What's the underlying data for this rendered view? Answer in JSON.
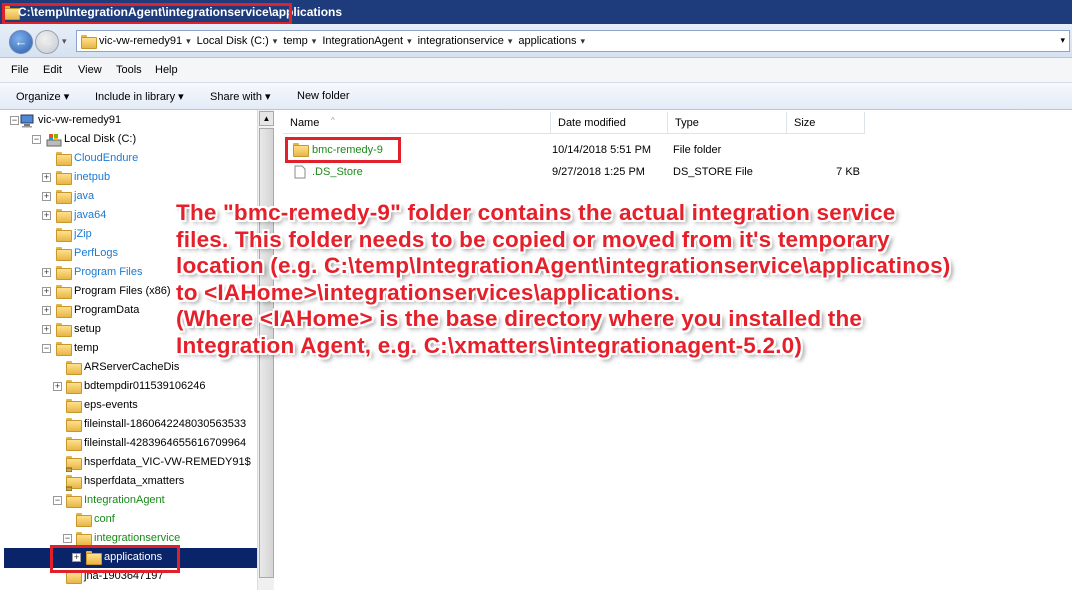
{
  "window": {
    "title": "C:\\temp\\IntegrationAgent\\integrationservice\\applications"
  },
  "address": {
    "crumbs": [
      "vic-vw-remedy91",
      "Local Disk (C:)",
      "temp",
      "IntegrationAgent",
      "integrationservice",
      "applications"
    ]
  },
  "menu": [
    "File",
    "Edit",
    "View",
    "Tools",
    "Help"
  ],
  "toolbar": {
    "organize": "Organize ▾",
    "include_in_library": "Include in library ▾",
    "share_with": "Share with ▾",
    "new_folder": "New folder"
  },
  "tree": [
    {
      "label": "vic-vw-remedy91",
      "indent": 0,
      "icon": "computer-icon",
      "expander": "−",
      "color": "#000"
    },
    {
      "label": "Local Disk (C:)",
      "indent": 1,
      "icon": "drive-icon",
      "expander": "−",
      "color": "#000"
    },
    {
      "label": "CloudEndure",
      "indent": 2,
      "icon": "folder-icon",
      "expander": "",
      "color": "#1a7ad4"
    },
    {
      "label": "inetpub",
      "indent": 2,
      "icon": "folder-icon",
      "expander": "+",
      "color": "#1a7ad4"
    },
    {
      "label": "java",
      "indent": 2,
      "icon": "folder-icon",
      "expander": "+",
      "color": "#1a7ad4"
    },
    {
      "label": "java64",
      "indent": 2,
      "icon": "folder-icon",
      "expander": "+",
      "color": "#1a7ad4"
    },
    {
      "label": "jZip",
      "indent": 2,
      "icon": "folder-icon",
      "expander": "",
      "color": "#1a7ad4"
    },
    {
      "label": "PerfLogs",
      "indent": 2,
      "icon": "folder-icon",
      "expander": "",
      "color": "#1a7ad4"
    },
    {
      "label": "Program Files",
      "indent": 2,
      "icon": "folder-icon",
      "expander": "+",
      "color": "#1a7ad4"
    },
    {
      "label": "Program Files (x86)",
      "indent": 2,
      "icon": "folder-icon",
      "expander": "+",
      "color": "#000"
    },
    {
      "label": "ProgramData",
      "indent": 2,
      "icon": "folder-icon",
      "expander": "+",
      "color": "#000"
    },
    {
      "label": "setup",
      "indent": 2,
      "icon": "folder-icon",
      "expander": "+",
      "color": "#000"
    },
    {
      "label": "temp",
      "indent": 2,
      "icon": "folder-icon",
      "expander": "−",
      "color": "#000"
    },
    {
      "label": "ARServerCacheDis",
      "indent": 3,
      "icon": "folder-icon",
      "expander": "",
      "color": "#000"
    },
    {
      "label": "bdtempdir011539106246",
      "indent": 3,
      "icon": "folder-icon",
      "expander": "+",
      "color": "#000"
    },
    {
      "label": "eps-events",
      "indent": 3,
      "icon": "folder-icon",
      "expander": "",
      "color": "#000"
    },
    {
      "label": "fileinstall-1860642248030563533",
      "indent": 3,
      "icon": "folder-icon",
      "expander": "",
      "color": "#000"
    },
    {
      "label": "fileinstall-4283964655616709964",
      "indent": 3,
      "icon": "folder-icon",
      "expander": "",
      "color": "#000"
    },
    {
      "label": "hsperfdata_VIC-VW-REMEDY91$",
      "indent": 3,
      "icon": "locked-folder-icon",
      "expander": "",
      "color": "#000"
    },
    {
      "label": "hsperfdata_xmatters",
      "indent": 3,
      "icon": "locked-folder-icon",
      "expander": "",
      "color": "#000"
    },
    {
      "label": "IntegrationAgent",
      "indent": 3,
      "icon": "folder-icon",
      "expander": "−",
      "color": "#1a8a1a"
    },
    {
      "label": "conf",
      "indent": 4,
      "icon": "folder-icon",
      "expander": "",
      "color": "#1a8a1a"
    },
    {
      "label": "integrationservice",
      "indent": 4,
      "icon": "folder-icon",
      "expander": "−",
      "color": "#1a8a1a"
    },
    {
      "label": "applications",
      "indent": 5,
      "icon": "folder-icon",
      "expander": "+",
      "color": "#fff",
      "selected": true
    },
    {
      "label": "jna-1903647197",
      "indent": 3,
      "icon": "folder-icon",
      "expander": "",
      "color": "#000"
    }
  ],
  "columns": {
    "name": "Name",
    "date": "Date modified",
    "type": "Type",
    "size": "Size"
  },
  "files": [
    {
      "name": "bmc-remedy-9",
      "date": "10/14/2018 5:51 PM",
      "type": "File folder",
      "size": "",
      "icon": "folder-icon",
      "color": "#1a8a1a"
    },
    {
      "name": ".DS_Store",
      "date": "9/27/2018 1:25 PM",
      "type": "DS_STORE File",
      "size": "7 KB",
      "icon": "file-icon",
      "color": "#1a8a1a"
    }
  ],
  "annotation": {
    "lines": [
      "The \"bmc-remedy-9\" folder contains the actual integration service",
      "files. This folder needs to be copied or moved from it's temporary",
      "location (e.g. C:\\temp\\IntegrationAgent\\integrationservice\\applicatinos)",
      "to <IAHome>\\integrationservices\\applications.",
      "(Where <IAHome> is the base directory where you installed the",
      "Integration Agent, e.g. C:\\xmatters\\integrationagent-5.2.0)"
    ],
    "color": "#e5202a"
  },
  "colors": {
    "titlebar": "#1e3c7c",
    "highlight": "#e0202a",
    "selection": "#0a246a"
  }
}
